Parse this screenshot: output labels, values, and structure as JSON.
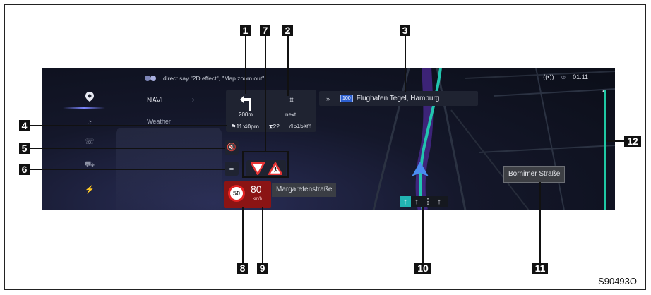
{
  "voice_hint": {
    "text": "direct say \"2D effect\", \"Map zoom out\"",
    "icon": "voice-assistant-icon"
  },
  "status_bar": {
    "signal_icon": "wireless-signal-icon",
    "mute_icon": "mute-icon",
    "time": "01:11"
  },
  "sidebar": {
    "items": [
      {
        "icon": "navigation-pin-icon",
        "label": "NAVI",
        "active": true
      },
      {
        "icon": "weather-icon",
        "label": "Weather"
      },
      {
        "icon": "phone-icon",
        "label": ""
      },
      {
        "icon": "car-icon",
        "label": ""
      },
      {
        "icon": "charging-plug-icon",
        "label": ""
      }
    ],
    "expand_icon": "chevron-right-icon"
  },
  "maneuver": {
    "distance": "200m",
    "next_label": "next",
    "turn_icon": "turn-left-arrow-icon",
    "next_icon": "motorway-icon"
  },
  "route_info": {
    "eta": "11:40pm",
    "time_remaining": "22",
    "distance_remaining": "515km"
  },
  "destination": {
    "prefix": "»",
    "road_number": "100",
    "text": "Flughafen Tegel, Hamburg"
  },
  "buttons": {
    "mute_guidance_icon": "mute-guidance-icon",
    "menu_icon": "menu-icon"
  },
  "warnings": [
    "yield-sign-icon",
    "pedestrian-warning-icon"
  ],
  "speed": {
    "limit": "50",
    "current": "80",
    "unit": "km/h"
  },
  "current_street": "Margaretenstraße",
  "lanes": [
    {
      "icon": "lane-straight-arrow-icon",
      "active": true
    },
    {
      "icon": "lane-straight-arrow-icon",
      "active": false
    },
    {
      "icon": "lane-straight-arrow-icon",
      "active": false
    },
    {
      "icon": "lane-straight-arrow-icon",
      "active": false
    }
  ],
  "street_label": "Bornimer Straße",
  "callouts": [
    "1",
    "2",
    "3",
    "4",
    "5",
    "6",
    "7",
    "8",
    "9",
    "10",
    "11",
    "12"
  ],
  "figure_code": "S90493O",
  "colors": {
    "range_bar": "#1ec8a3",
    "route": "#22c4ae",
    "speed_bg": "#8b1414",
    "position_arrow": "#4a8df0"
  }
}
